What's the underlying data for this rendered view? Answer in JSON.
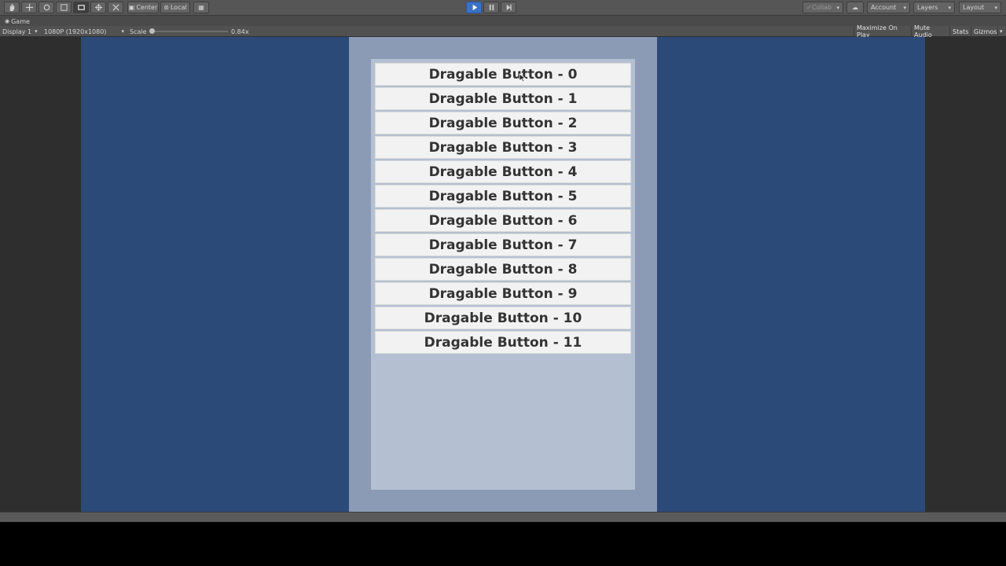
{
  "toolbar": {
    "tools": [
      "hand-tool",
      "move-tool",
      "rotate-tool",
      "scale-tool",
      "rect-tool",
      "transform-tool",
      "custom-tool"
    ],
    "pivot_label": "Center",
    "space_label": "Local",
    "collab_label": "Collab",
    "account_label": "Account",
    "layers_label": "Layers",
    "layout_label": "Layout"
  },
  "tab": {
    "label": "Game"
  },
  "gamebar": {
    "display_label": "Display 1",
    "resolution_label": "1080P (1920x1080)",
    "scale_label": "Scale",
    "scale_value": "0.84x",
    "maximize_label": "Maximize On Play",
    "mute_label": "Mute Audio",
    "stats_label": "Stats",
    "gizmos_label": "Gizmos"
  },
  "game": {
    "buttons": [
      "Dragable Button - 0",
      "Dragable Button - 1",
      "Dragable Button - 2",
      "Dragable Button - 3",
      "Dragable Button - 4",
      "Dragable Button - 5",
      "Dragable Button - 6",
      "Dragable Button - 7",
      "Dragable Button - 8",
      "Dragable Button - 9",
      "Dragable Button - 10",
      "Dragable Button - 11"
    ]
  },
  "colors": {
    "canvas": "#2c4a78",
    "panel_outer": "#8b9bb5",
    "panel_inner": "#b4c0d2",
    "button_bg": "#f2f2f2",
    "play_accent": "#3a72c6"
  }
}
